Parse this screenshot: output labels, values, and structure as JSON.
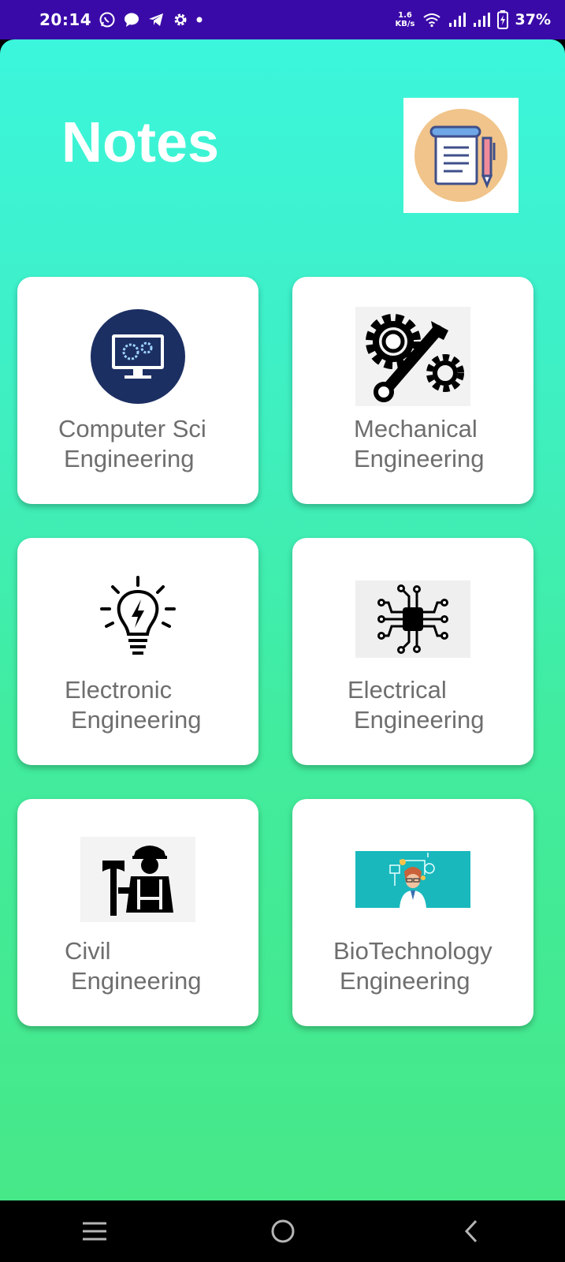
{
  "status_bar": {
    "time": "20:14",
    "net_speed_value": "1.6",
    "net_speed_unit": "KB/s",
    "battery_percent": "37%",
    "notification_icons": [
      "whatsapp-icon",
      "chat-bubble-icon",
      "telegram-icon",
      "settings-gear-icon",
      "dot-icon"
    ],
    "system_icons": [
      "wifi-icon",
      "signal-icon",
      "signal-icon",
      "battery-charging-icon"
    ],
    "background_color": "#3a0aa8"
  },
  "app": {
    "title": "Notes",
    "logo_icon": "notepad-pen-icon",
    "gradient_top": "#3bf6dc",
    "gradient_bottom": "#46e888"
  },
  "cards": [
    {
      "line1": "Computer Sci",
      "line2": "Engineering",
      "icon": "computer-monitor-gears-icon"
    },
    {
      "line1": "Mechanical",
      "line2": "Engineering",
      "icon": "gear-wrench-icon"
    },
    {
      "line1": "Electronic",
      "line2": "Engineering",
      "icon": "lightbulb-icon"
    },
    {
      "line1": "Electrical",
      "line2": "Engineering",
      "icon": "circuit-chip-icon"
    },
    {
      "line1": "Civil",
      "line2": "Engineering",
      "icon": "construction-worker-icon"
    },
    {
      "line1": "BioTechnology",
      "line2": "Engineering",
      "icon": "scientist-icon"
    }
  ],
  "nav_bar": {
    "buttons": [
      "menu-icon",
      "home-icon",
      "back-icon"
    ]
  }
}
